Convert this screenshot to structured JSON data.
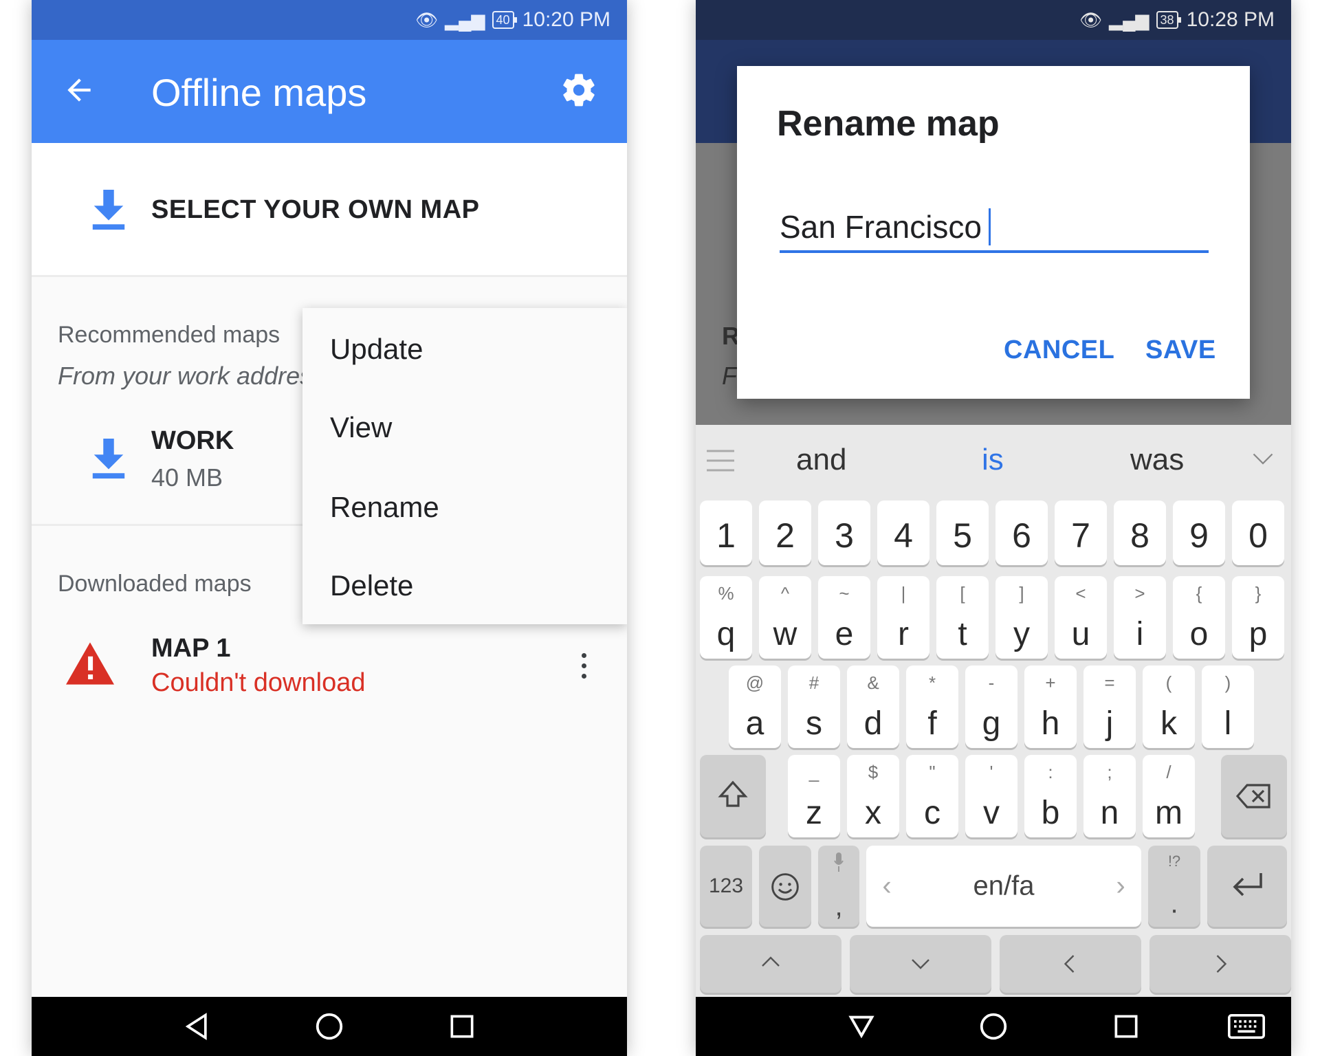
{
  "left": {
    "status": {
      "time": "10:20 PM",
      "battery": "40"
    },
    "appbar": {
      "title": "Offline maps"
    },
    "select_own_map": "SELECT YOUR OWN MAP",
    "recommended": {
      "heading": "Recommended maps",
      "subtitle": "From your work address"
    },
    "work_map": {
      "name": "WORK",
      "size": "40 MB"
    },
    "downloaded": {
      "heading": "Downloaded maps"
    },
    "map1": {
      "name": "MAP 1",
      "status": "Couldn't download"
    },
    "menu": {
      "items": [
        "Update",
        "View",
        "Rename",
        "Delete"
      ]
    }
  },
  "right": {
    "status": {
      "time": "10:28 PM",
      "battery": "38"
    },
    "background_fragments": {
      "r": "R",
      "f": "F"
    },
    "dialog": {
      "title": "Rename map",
      "value": "San Francisco",
      "cancel": "CANCEL",
      "save": "SAVE"
    },
    "keyboard": {
      "suggestions": [
        "and",
        "is",
        "was"
      ],
      "numbers": [
        "1",
        "2",
        "3",
        "4",
        "5",
        "6",
        "7",
        "8",
        "9",
        "0"
      ],
      "row1": [
        {
          "sub": "%",
          "main": "q"
        },
        {
          "sub": "^",
          "main": "w"
        },
        {
          "sub": "~",
          "main": "e"
        },
        {
          "sub": "|",
          "main": "r"
        },
        {
          "sub": "[",
          "main": "t"
        },
        {
          "sub": "]",
          "main": "y"
        },
        {
          "sub": "<",
          "main": "u"
        },
        {
          "sub": ">",
          "main": "i"
        },
        {
          "sub": "{",
          "main": "o"
        },
        {
          "sub": "}",
          "main": "p"
        }
      ],
      "row2": [
        {
          "sub": "@",
          "main": "a"
        },
        {
          "sub": "#",
          "main": "s"
        },
        {
          "sub": "&",
          "main": "d"
        },
        {
          "sub": "*",
          "main": "f"
        },
        {
          "sub": "-",
          "main": "g"
        },
        {
          "sub": "+",
          "main": "h"
        },
        {
          "sub": "=",
          "main": "j"
        },
        {
          "sub": "(",
          "main": "k"
        },
        {
          "sub": ")",
          "main": "l"
        }
      ],
      "row3": [
        {
          "sub": "_",
          "main": "z"
        },
        {
          "sub": "$",
          "main": "x"
        },
        {
          "sub": "\"",
          "main": "c"
        },
        {
          "sub": "'",
          "main": "v"
        },
        {
          "sub": ":",
          "main": "b"
        },
        {
          "sub": ";",
          "main": "n"
        },
        {
          "sub": "/",
          "main": "m"
        }
      ],
      "key_123": "123",
      "space": "en/fa",
      "comma": ",",
      "period": ".",
      "period_sub": "!?"
    }
  },
  "colors": {
    "primary": "#4285f4",
    "error": "#d93025",
    "accent": "#2f74e6"
  }
}
